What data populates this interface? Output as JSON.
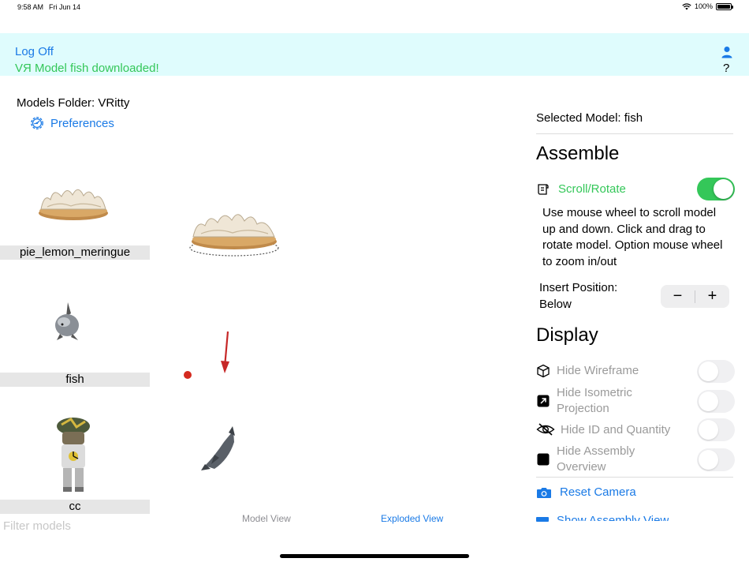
{
  "status_bar": {
    "time": "9:58 AM",
    "date": "Fri Jun 14",
    "battery": "100%"
  },
  "banner": {
    "logoff_label": "Log Off",
    "message": "VЯ Model fish downloaded!",
    "help_label": "?"
  },
  "sidebar": {
    "folder_label": "Models Folder: VRitty",
    "preferences_label": "Preferences",
    "models": [
      {
        "name": "pie_lemon_meringue"
      },
      {
        "name": "fish"
      },
      {
        "name": "cc"
      }
    ],
    "filter_placeholder": "Filter models"
  },
  "viewport": {
    "tab_model": "Model View",
    "tab_exploded": "Exploded View"
  },
  "panel": {
    "selected_model": "Selected Model: fish",
    "assemble_title": "Assemble",
    "scroll_rotate_label": "Scroll/Rotate",
    "scroll_rotate_on": true,
    "description": "Use mouse wheel to scroll model up and down. Click and drag to rotate model. Option mouse wheel to zoom in/out",
    "insert_position_label": "Insert Position: Below",
    "stepper_minus": "−",
    "stepper_plus": "+",
    "display_title": "Display",
    "display_options": [
      {
        "label": "Hide Wireframe",
        "on": false,
        "icon": "cube-icon"
      },
      {
        "label": "Hide Isometric Projection",
        "on": false,
        "icon": "arrow-up-right-square-icon"
      },
      {
        "label": "Hide ID and Quantity",
        "on": false,
        "icon": "eye-slash-icon"
      },
      {
        "label": "Hide Assembly Overview",
        "on": false,
        "icon": "square-fill-icon"
      }
    ],
    "reset_camera_label": "Reset Camera",
    "cut_off_label": "Show Assembly View"
  },
  "colors": {
    "accent": "#1a7ae6",
    "green": "#34c759",
    "banner_bg": "#dffcfd"
  }
}
